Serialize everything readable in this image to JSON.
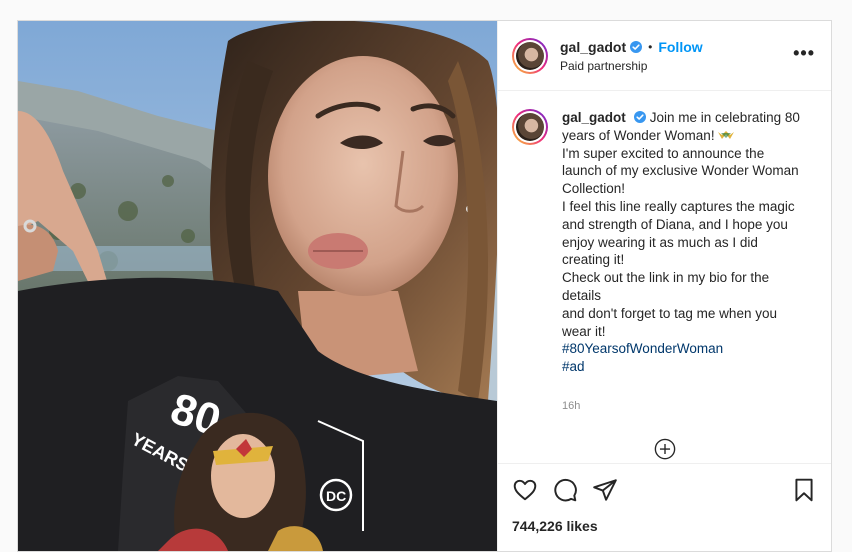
{
  "post": {
    "username": "gal_gadot",
    "follow_label": "Follow",
    "dot": "•",
    "subtitle": "Paid partnership",
    "more_label": "•••",
    "caption_username": "gal_gadot",
    "caption_lines": [
      "Join me in celebrating 80",
      "years of Wonder Woman! ",
      "I'm super excited to announce the",
      "launch of my exclusive Wonder Woman",
      "Collection!",
      "I feel this line really captures the magic",
      "and strength of Diana, and I hope you",
      "enjoy wearing it as much as I did",
      "creating it!",
      "Check out the link in my bio for the",
      "details",
      "and don't forget to tag me when you",
      "wear it!"
    ],
    "hashtags": [
      "#80YearsofWonderWoman",
      "#ad"
    ],
    "time": "16h",
    "likes": "744,226 likes",
    "shirt_text_1": "80",
    "shirt_text_2": "YEARS",
    "shirt_logo": "DC"
  },
  "colors": {
    "follow": "#0095f6",
    "verified": "#3897f0",
    "hashtag": "#00376b",
    "time": "#8e8e8e"
  },
  "icons": [
    "verified-badge-icon",
    "more-options-icon",
    "load-more-icon",
    "heart-icon",
    "comment-icon",
    "share-icon",
    "bookmark-icon"
  ]
}
